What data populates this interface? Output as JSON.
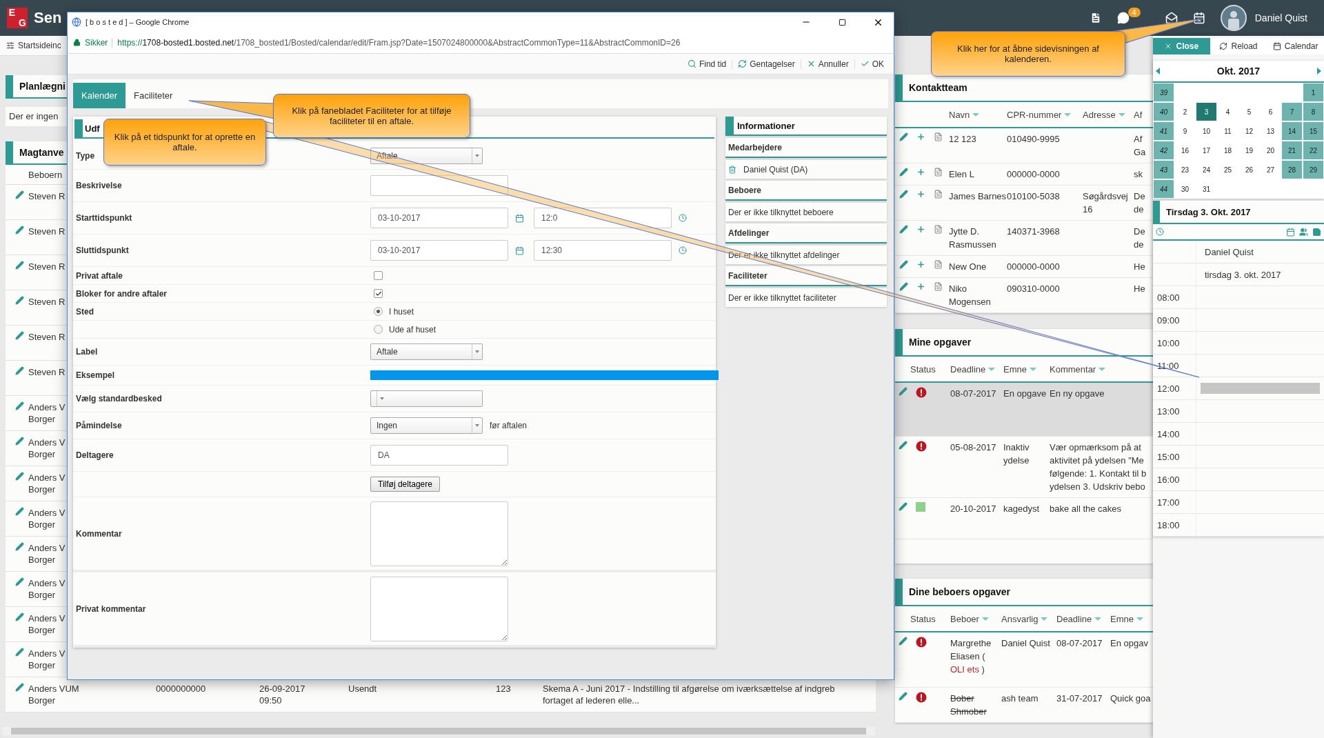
{
  "topbar": {
    "logo": "EG",
    "app_name": "Sen",
    "chat_badge": "4",
    "user": "Daniel Quist"
  },
  "subbar": {
    "label": "Startsideinc"
  },
  "planning_panel": {
    "title": "Planlægni",
    "message": "Der er ingen"
  },
  "restraint_panel": {
    "title": "Magtanve",
    "column_1": "Beboern",
    "rows": [
      {
        "name": "Steven R"
      },
      {
        "name": "Steven R"
      },
      {
        "name": "Steven R"
      },
      {
        "name": "Steven R"
      },
      {
        "name": "Steven R"
      },
      {
        "name": "Steven R"
      },
      {
        "name": "Anders V",
        "type": "Borger"
      },
      {
        "name": "Anders V",
        "type": "Borger"
      },
      {
        "name": "Anders V",
        "type": "Borger"
      },
      {
        "name": "Anders V",
        "type": "Borger"
      },
      {
        "name": "Anders V",
        "type": "Borger"
      },
      {
        "name": "Anders V",
        "type": "Borger"
      },
      {
        "name": "Anders V",
        "type": "Borger"
      },
      {
        "name": "Anders V",
        "type": "Borger"
      },
      {
        "name": "Anders VUM",
        "type": "Borger",
        "cpr": "0000000000",
        "date": "26-09-2017 09:50",
        "status": "Usendt",
        "number": "123",
        "text": "Skema A - Juni 2017 - Indstilling til afgørelse om iværksættelse af indgreb fortaget af lederen elle..."
      }
    ]
  },
  "window": {
    "title": "[ b o s t e d ] – Google Chrome",
    "secure_label": "Sikker",
    "url_scheme": "https://",
    "url_host": "1708-bosted1.bosted.net",
    "url_path": "/1708_bosted1/Bosted/calendar/edit/Fram.jsp?Date=1507024800000&AbstractCommonType=11&AbstractCommonID=26",
    "toolbar": [
      {
        "label": "Find tid"
      },
      {
        "label": "Gentagelser"
      },
      {
        "label": "Annuller"
      },
      {
        "label": "OK"
      }
    ],
    "tabs": [
      {
        "label": "Kalender",
        "selected": true
      },
      {
        "label": "Faciliteter",
        "selected": false
      }
    ],
    "form": {
      "title": "Udf",
      "rows": [
        {
          "kind": "select",
          "label": "Type",
          "value": "Aftale"
        },
        {
          "kind": "text",
          "label": "Beskrivelse"
        },
        {
          "kind": "datetime",
          "label": "Starttidspunkt",
          "date": "03-10-2017",
          "time": "12:0"
        },
        {
          "kind": "datetime",
          "label": "Sluttidspunkt",
          "date": "03-10-2017",
          "time": "12:30"
        },
        {
          "kind": "checkbox",
          "label": "Privat aftale",
          "checked": false
        },
        {
          "kind": "checkbox",
          "label": "Bloker for andre aftaler",
          "checked": true
        },
        {
          "kind": "radio",
          "label": "Sted",
          "option": "I huset",
          "selected": true
        },
        {
          "kind": "radio",
          "option": "Ude af huset",
          "selected": false
        },
        {
          "kind": "select",
          "label": "Label",
          "value": "Aftale"
        },
        {
          "kind": "swatch",
          "label": "Eksempel",
          "color": "#0096f0"
        },
        {
          "kind": "select",
          "label": "Vælg standardbesked"
        },
        {
          "kind": "select",
          "label": "Påmindelse",
          "value": "Ingen",
          "suffix": "før aftalen"
        },
        {
          "kind": "text",
          "label": "Deltagere",
          "value": "DA"
        },
        {
          "kind": "button",
          "button": "Tilføj deltagere"
        },
        {
          "kind": "textarea",
          "label": "Kommentar"
        },
        {
          "kind": "textarea",
          "label": "Privat kommentar"
        }
      ]
    },
    "info": {
      "title": "Informationer",
      "sections": [
        {
          "title": "Medarbejdere",
          "items": [
            {
              "text": "Daniel Quist (DA)",
              "removable": true
            }
          ]
        },
        {
          "title": "Beboere",
          "items": [
            {
              "text": "Der er ikke tilknyttet beboere",
              "removable": false
            }
          ]
        },
        {
          "title": "Afdelinger",
          "items": [
            {
              "text": "Der er ikke tilknyttet afdelinger",
              "removable": false
            }
          ]
        },
        {
          "title": "Faciliteter",
          "items": [
            {
              "text": "Der er ikke tilknyttet faciliteter",
              "removable": false
            }
          ]
        }
      ]
    }
  },
  "contact_team": {
    "title": "Kontaktteam",
    "columns": [
      "Navn",
      "CPR-nummer",
      "Adresse",
      "Af"
    ],
    "rows": [
      {
        "name": "12 123",
        "cpr": "010490-9995",
        "column_4": "Af Ga"
      },
      {
        "name": "Elen L",
        "cpr": "000000-0000",
        "column_4": "sk"
      },
      {
        "name": "James Barnes",
        "cpr": "010100-5038",
        "address": "Søgårdsvej 16",
        "column_4": "De de"
      },
      {
        "name": "Jytte D. Rasmussen",
        "cpr": "140371-3968",
        "column_4": "De de"
      },
      {
        "name": "New One",
        "cpr": "000000-0000",
        "column_4": "He"
      },
      {
        "name": "Niko Mogensen",
        "cpr": "090310-0000",
        "column_4": "He"
      }
    ]
  },
  "my_tasks": {
    "title": "Mine opgaver",
    "columns": [
      {
        "label": "Status",
        "sortable": false
      },
      {
        "label": "Deadline",
        "sortable": true
      },
      {
        "label": "Emne",
        "sortable": true
      },
      {
        "label": "Kommentar",
        "sortable": true
      }
    ],
    "rows": [
      {
        "kind": "alert",
        "deadline": "08-07-2017",
        "subject": "En opgave",
        "comment": "En ny opgave",
        "selected": true
      },
      {
        "kind": "alert",
        "deadline": "05-08-2017",
        "subject": "Inaktiv ydelse",
        "comment": "Vær opmærksom på at aktivitet på ydelsen \"Me følgende: 1. Kontakt til b ydelsen 3. Udskriv bebo",
        "selected": false
      },
      {
        "kind": "square",
        "deadline": "20-10-2017",
        "subject": "kagedyst",
        "comment": "bake all the cakes",
        "selected": false
      }
    ]
  },
  "resident_tasks": {
    "title": "Dine beboers opgaver",
    "columns": [
      {
        "label": "Status",
        "sortable": false
      },
      {
        "label": "Beboer",
        "sortable": true
      },
      {
        "label": "Ansvarlig",
        "sortable": true
      },
      {
        "label": "Deadline",
        "sortable": true
      },
      {
        "label": "Emne",
        "sortable": true
      }
    ],
    "rows": [
      {
        "kind": "alert",
        "resident": "Margrethe Eliasen (",
        "resident_tag": "OLI ets",
        "resident_end": ")",
        "responsible": "Daniel Quist",
        "deadline": "08-07-2017",
        "subject": "En opgav",
        "inactive": false
      },
      {
        "kind": "alert",
        "resident": "Bober Shmober",
        "responsible": "ash team",
        "deadline": "31-07-2017",
        "subject": "Quick goa",
        "inactive": true
      }
    ]
  },
  "sidebar": {
    "buttons": [
      {
        "label": "Close",
        "kind": "primary"
      },
      {
        "label": "Reload",
        "kind": "plain"
      },
      {
        "label": "Calendar",
        "kind": "plain"
      }
    ],
    "month": "Okt. 2017",
    "weeks": [
      {
        "week": "39",
        "days": [
          {
            "day": "1",
            "selected": false
          }
        ]
      },
      {
        "week": "40",
        "days": [
          {
            "day": "2",
            "selected": false
          },
          {
            "day": "3",
            "selected": true
          },
          {
            "day": "4",
            "selected": false
          },
          {
            "day": "5",
            "selected": false
          },
          {
            "day": "6",
            "selected": false
          },
          {
            "day": "7",
            "selected": false
          },
          {
            "day": "8",
            "selected": false
          }
        ]
      },
      {
        "week": "41",
        "days": [
          {
            "day": "9",
            "selected": false
          },
          {
            "day": "10",
            "selected": false
          },
          {
            "day": "11",
            "selected": false
          },
          {
            "day": "12",
            "selected": false
          },
          {
            "day": "13",
            "selected": false
          },
          {
            "day": "14",
            "selected": false
          },
          {
            "day": "15",
            "selected": false
          }
        ]
      },
      {
        "week": "42",
        "days": [
          {
            "day": "16",
            "selected": false
          },
          {
            "day": "17",
            "selected": false
          },
          {
            "day": "18",
            "selected": false
          },
          {
            "day": "19",
            "selected": false
          },
          {
            "day": "20",
            "selected": false
          },
          {
            "day": "21",
            "selected": false
          },
          {
            "day": "22",
            "selected": false
          }
        ]
      },
      {
        "week": "43",
        "days": [
          {
            "day": "23",
            "selected": false
          },
          {
            "day": "24",
            "selected": false
          },
          {
            "day": "25",
            "selected": false
          },
          {
            "day": "26",
            "selected": false
          },
          {
            "day": "27",
            "selected": false
          },
          {
            "day": "28",
            "selected": false
          },
          {
            "day": "29",
            "selected": false
          }
        ]
      },
      {
        "week": "44",
        "days": [
          {
            "day": "30",
            "selected": false
          },
          {
            "day": "31",
            "selected": false
          }
        ]
      }
    ],
    "day_title": "Tirsdag 3. Okt. 2017",
    "person": "Daniel Quist",
    "date": "tirsdag 3. okt. 2017",
    "slots": [
      {
        "time": "08:00",
        "selected": false
      },
      {
        "time": "09:00",
        "selected": false
      },
      {
        "time": "10:00",
        "selected": false
      },
      {
        "time": "11:00",
        "selected": false
      },
      {
        "time": "12:00",
        "selected": true
      },
      {
        "time": "13:00",
        "selected": false
      },
      {
        "time": "14:00",
        "selected": false
      },
      {
        "time": "15:00",
        "selected": false
      },
      {
        "time": "16:00",
        "selected": false
      },
      {
        "time": "17:00",
        "selected": false
      },
      {
        "time": "18:00",
        "selected": false
      }
    ]
  },
  "callouts": [
    {
      "text": "Klik her for at åbne sidevisningen af kalenderen."
    },
    {
      "text": "Klik på fanebladet Faciliteter for at tilføje faciliteter til en aftale."
    },
    {
      "text": "Klik på et tidspunkt for at oprette en aftale."
    }
  ]
}
